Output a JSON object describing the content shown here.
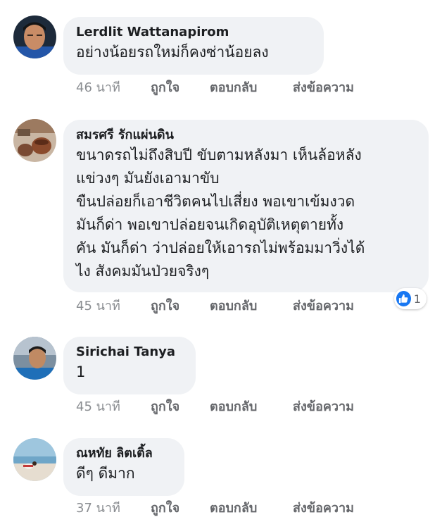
{
  "actions": {
    "like": "ถูกใจ",
    "reply": "ตอบกลับ",
    "send_message": "ส่งข้อความ"
  },
  "comments": [
    {
      "author": "Lerdlit Wattanapirom",
      "text": "อย่างน้อยรถใหม่ก็คงซ่าน้อยลง",
      "time": "46 นาที"
    },
    {
      "author": "สมรศรี รักแผ่นดิน",
      "text": "ขนาดรถไม่ถึงสิบปี ขับตามหลังมา เห็นล้อหลัง\nแข่วงๆ  มันยังเอามาขับ\nขืนปล่อยก็เอาชีวิตคนไปเสี่ยง  พอเขาเข้มงวด\nมันก็ด่า  พอเขาปล่อยจนเกิดอุบัติเหตุตายทั้ง\nคัน มันก็ด่า ว่าปล่อยให้เอารถไม่พร้อมมาวิ่งได้\nไง สังคมมันป่วยจริงๆ",
      "time": "45 นาที",
      "reaction_icon": "thumbs-up-icon",
      "reaction_count": "1"
    },
    {
      "author": "Sirichai Tanya",
      "text": "1",
      "time": "45 นาที"
    },
    {
      "author": "ณหทัย ลิตเติ้ล",
      "text": "ดีๆ ดีมาก",
      "time": "37 นาที"
    }
  ],
  "colors": {
    "bubble": "#f0f2f5",
    "meta_text": "#65676b",
    "reaction_blue": "#1877f2"
  }
}
